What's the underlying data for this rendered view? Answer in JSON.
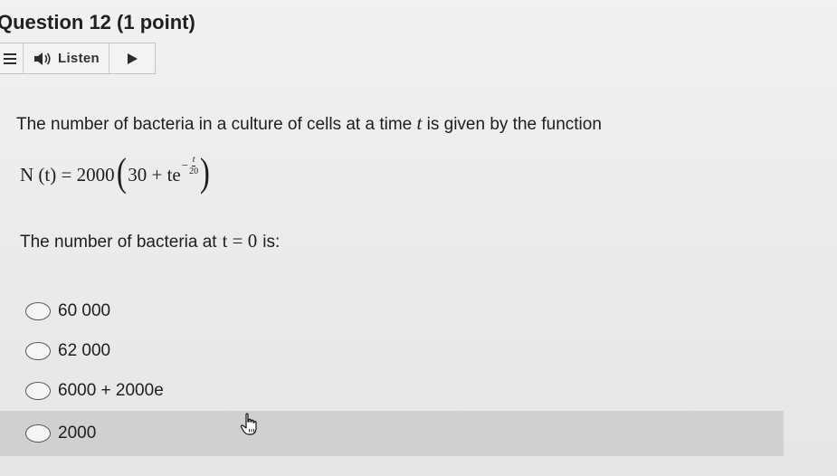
{
  "question": {
    "title": "Question 12 (1 point)"
  },
  "toolbar": {
    "menu_icon": "hamburger-menu-icon",
    "speaker_icon": "speaker-icon",
    "listen_label": "Listen",
    "play_icon": "play-icon"
  },
  "stem": {
    "text_before": "The number of bacteria in a culture of cells at a time ",
    "variable": "t",
    "text_after": " is given by the function"
  },
  "formula": {
    "lhs": "N (t) = 2000",
    "inner": "30 + te",
    "exp_sign": "−",
    "exp_num": "t",
    "exp_den": "20"
  },
  "prompt": {
    "text_before": "The number of bacteria at",
    "math": "t = 0",
    "text_after": "is:"
  },
  "options": [
    {
      "label": "60 000",
      "selected": false,
      "hovered": false
    },
    {
      "label": "62 000",
      "selected": false,
      "hovered": false
    },
    {
      "label": "6000 + 2000e",
      "selected": false,
      "hovered": false
    },
    {
      "label": "2000",
      "selected": false,
      "hovered": true
    }
  ],
  "colors": {
    "hover_row": "#cfd0cf",
    "page_background": "#ebebea"
  }
}
